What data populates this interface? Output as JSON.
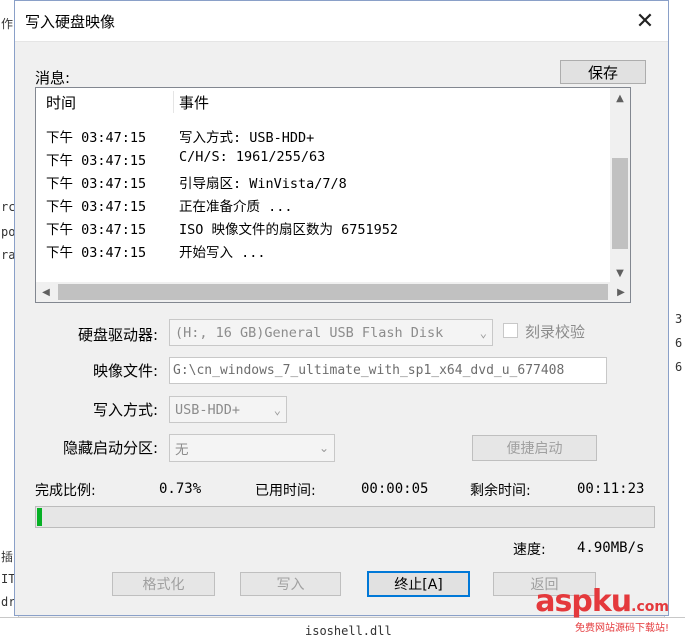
{
  "window": {
    "title": "写入硬盘映像"
  },
  "messages": {
    "label": "消息:",
    "save_button": "保存",
    "columns": {
      "time": "时间",
      "event": "事件"
    },
    "rows": [
      {
        "time": "下午 03:47:15",
        "event": "写入方式: USB-HDD+"
      },
      {
        "time": "下午 03:47:15",
        "event": "C/H/S: 1961/255/63"
      },
      {
        "time": "下午 03:47:15",
        "event": "引导扇区: WinVista/7/8"
      },
      {
        "time": "下午 03:47:15",
        "event": "正在准备介质 ..."
      },
      {
        "time": "下午 03:47:15",
        "event": "ISO 映像文件的扇区数为 6751952"
      },
      {
        "time": "下午 03:47:15",
        "event": "开始写入 ..."
      }
    ]
  },
  "form": {
    "drive_label": "硬盘驱动器:",
    "drive_value": "(H:, 16 GB)General USB Flash Disk",
    "verify_label": "刻录校验",
    "image_label": "映像文件:",
    "image_value": "G:\\cn_windows_7_ultimate_with_sp1_x64_dvd_u_677408",
    "method_label": "写入方式:",
    "method_value": "USB-HDD+",
    "hidden_label": "隐藏启动分区:",
    "hidden_value": "无",
    "quick_boot_button": "便捷启动"
  },
  "status": {
    "progress_label": "完成比例:",
    "progress_value": "0.73%",
    "progress_fraction": 0.0073,
    "elapsed_label": "已用时间:",
    "elapsed_value": "00:00:05",
    "remaining_label": "剩余时间:",
    "remaining_value": "00:11:23",
    "speed_label": "速度:",
    "speed_value": "4.90MB/s"
  },
  "buttons": {
    "format": "格式化",
    "write": "写入",
    "abort": "终止[A]",
    "back": "返回"
  },
  "background": {
    "left_fragments": [
      "作",
      "rc",
      "po",
      "ra",
      "插",
      "IT",
      "dr"
    ],
    "right_fragments": [
      "3",
      "6",
      "6"
    ],
    "bottom_file": "isoshell.dll"
  },
  "watermark": {
    "brand": "aspku",
    "tld": ".com",
    "subtitle": "免费网站源码下载站!"
  },
  "colors": {
    "progress_fill": "#06b025",
    "accent": "#0078d7",
    "watermark": "#e4393c"
  }
}
